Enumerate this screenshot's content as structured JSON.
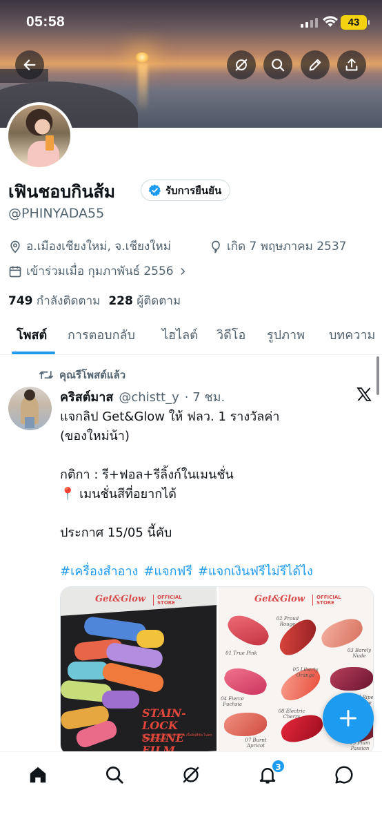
{
  "status_bar": {
    "time": "05:58",
    "battery": "43"
  },
  "profile": {
    "display_name": "เฟินชอบกินส้ม",
    "verify_label": "รับการยืนยัน",
    "handle": "@PHINYADA55",
    "location": "อ.เมืองเชียงใหม่, จ.เชียงใหม่",
    "birthday": "เกิด 7 พฤษภาคม 2537",
    "joined": "เข้าร่วมเมื่อ กุมภาพันธ์ 2556",
    "following_count": "749",
    "following_label": "กำลังติดตาม",
    "followers_count": "228",
    "followers_label": "ผู้ติดตาม"
  },
  "tabs": [
    "โพสต์",
    "การตอบกลับ",
    "ไฮไลต์",
    "วิดีโอ",
    "รูปภาพ",
    "บทความ"
  ],
  "post": {
    "repost_label": "คุณรีโพสต์แล้ว",
    "author": "คริสต์มาส",
    "author_handle": "@chistt_y",
    "time": "· 7 ชม.",
    "lines": [
      "แจกลิป Get&Glow ให้ ฟลว. 1 รางวัลค่า",
      "(ของใหม่น้า)",
      "กติกา : รี+ฟอล+รีลิ้งก์ในเมนชั่น",
      "📍 เมนชั่นสีที่อยากได้",
      "ประกาศ 15/05 นี้คับ"
    ],
    "hashtags": [
      "#เครื่องสำอาง",
      "#แจกฟรี",
      "#แจกเงินฟรีไม่รีได้ไง"
    ],
    "media": {
      "brand": "Get&Glow",
      "official": [
        "OFFICIAL",
        "STORE"
      ],
      "stain_lock": [
        "STAIN-LOCK",
        "SHINE FILM"
      ],
      "stain_small": "สูตรของเหลวใหม่ ติดทนนาน เนื้อลิปสีชัด ไม่ตกร่อง ผิวปากชุ่มชื้น",
      "shades": [
        "01 True Pink",
        "02 Proud Rouge",
        "03 Barely Nude",
        "04 Fierce Fuchsia",
        "05 Liberty Orange",
        "06 Ripe Grape",
        "07 Burnt Apricot",
        "08 Electric Cherry",
        "09 Plum Passion"
      ],
      "shade_colors": [
        "#d9434f",
        "#b8282c",
        "#e68877",
        "#e6547a",
        "#f06a52",
        "#8a2040",
        "#d96653",
        "#c5182d",
        "#8c2a3a"
      ]
    }
  },
  "notifications_badge": "3",
  "colors": {
    "accent": "#1d9bf0",
    "text": "#0f1419",
    "muted": "#536471"
  }
}
